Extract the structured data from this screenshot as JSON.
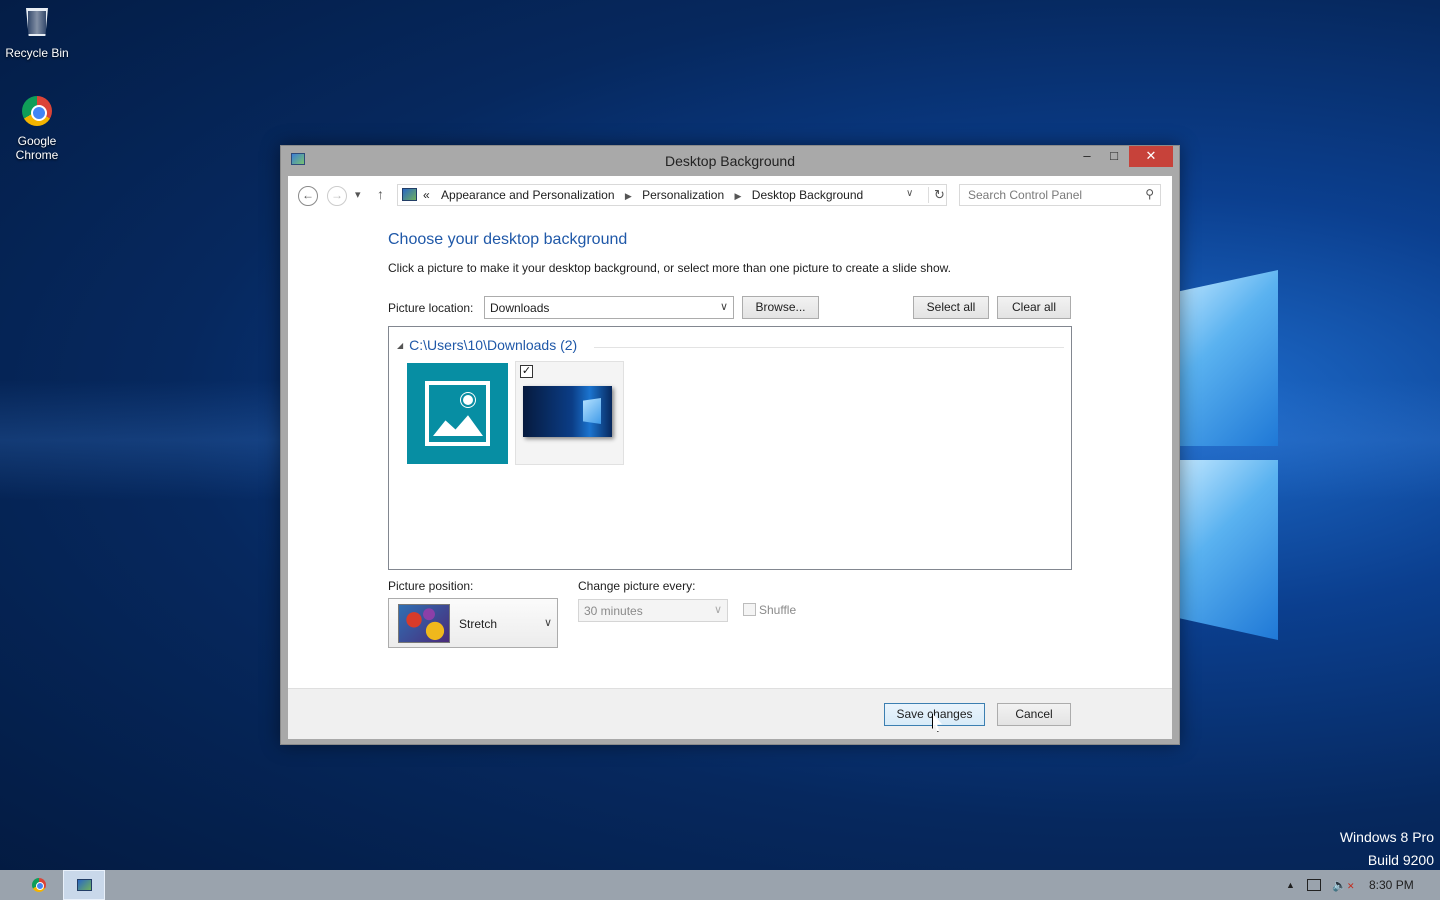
{
  "desktop": {
    "icons": [
      {
        "label": "Recycle Bin",
        "icon": "recycle-bin-icon"
      },
      {
        "label": "Google Chrome",
        "icon": "chrome-icon"
      }
    ],
    "watermark": {
      "line1": "Windows 8 Pro",
      "line2": "Build 9200"
    }
  },
  "window": {
    "title": "Desktop Background",
    "controls": {
      "minimize": "‒",
      "maximize": "□",
      "close": "✕"
    },
    "breadcrumb": {
      "overflow": "«",
      "items": [
        "Appearance and Personalization",
        "Personalization",
        "Desktop Background"
      ]
    },
    "search": {
      "placeholder": "Search Control Panel"
    }
  },
  "content": {
    "heading": "Choose your desktop background",
    "description": "Click a picture to make it your desktop background, or select more than one picture to create a slide show.",
    "picture_location": {
      "label": "Picture location:",
      "value": "Downloads"
    },
    "browse_button": "Browse...",
    "select_all_button": "Select all",
    "clear_all_button": "Clear all",
    "gallery": {
      "group_header": "C:\\Users\\10\\Downloads (2)",
      "thumbnails": [
        {
          "name": "placeholder-image",
          "checked": false
        },
        {
          "name": "windows-10-wallpaper",
          "checked": true
        }
      ]
    },
    "picture_position": {
      "label": "Picture position:",
      "value": "Stretch"
    },
    "change_picture": {
      "label": "Change picture every:",
      "value": "30 minutes"
    },
    "shuffle": {
      "label": "Shuffle",
      "checked": false
    }
  },
  "footer": {
    "save_button": "Save changes",
    "cancel_button": "Cancel"
  },
  "taskbar": {
    "clock": "8:30 PM"
  },
  "colors": {
    "link_blue": "#1f58a8",
    "close_red": "#c7423a",
    "tile_teal": "#078ea3"
  }
}
